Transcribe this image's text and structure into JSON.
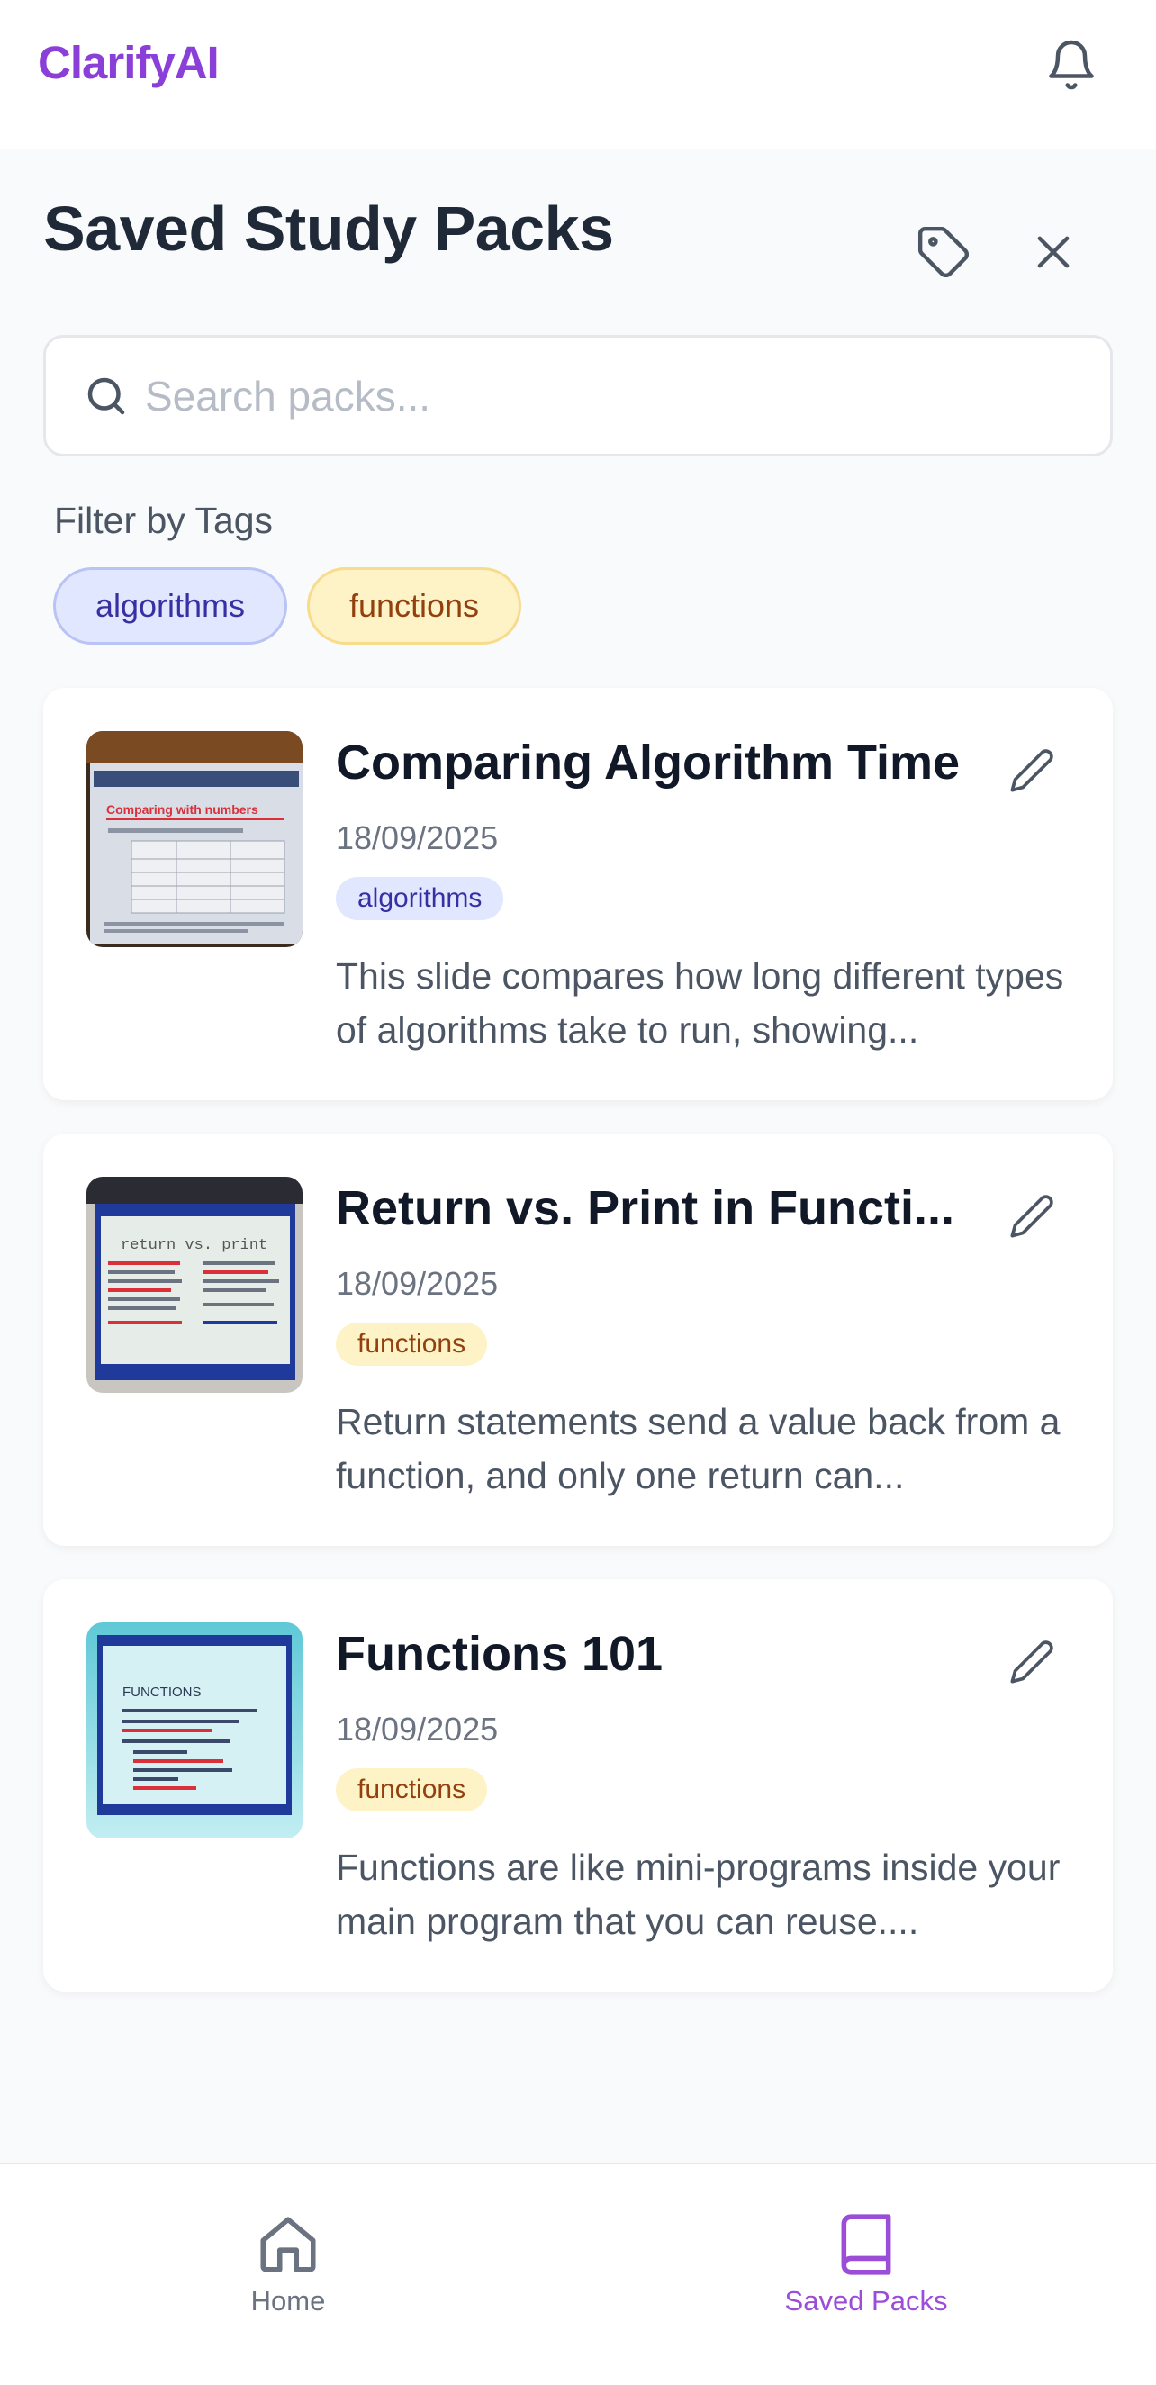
{
  "app": {
    "brand": "ClarifyAI",
    "brand_color": "#8b3fd9",
    "icons": {
      "notifications": "bell-icon",
      "tags": "tag-icon",
      "close": "close-icon",
      "search": "search-icon",
      "edit": "pencil-icon"
    }
  },
  "page": {
    "title": "Saved Study Packs"
  },
  "search": {
    "placeholder": "Search packs...",
    "value": ""
  },
  "filter": {
    "label": "Filter by Tags",
    "tags": [
      {
        "label": "algorithms",
        "color": "#e0e7ff"
      },
      {
        "label": "functions",
        "color": "#fef3c7"
      }
    ]
  },
  "packs": [
    {
      "title": "Comparing Algorithm Time",
      "date": "18/09/2025",
      "tag": "algorithms",
      "description": "This slide compares how long different types of algorithms take to run, showing...",
      "thumb_heading": "Comparing with numbers"
    },
    {
      "title": "Return vs. Print in Functi...",
      "date": "18/09/2025",
      "tag": "functions",
      "description": "Return statements send a value back from a function, and only one return can...",
      "thumb_heading": "return vs. print"
    },
    {
      "title": "Functions 101",
      "date": "18/09/2025",
      "tag": "functions",
      "description": "Functions are like mini-programs inside your main program that you can reuse....",
      "thumb_heading": "FUNCTIONS"
    }
  ],
  "nav": {
    "items": [
      {
        "label": "Home",
        "icon": "home-icon",
        "active": false
      },
      {
        "label": "Saved Packs",
        "icon": "book-icon",
        "active": true
      }
    ],
    "active_color": "#9b4dd8"
  }
}
